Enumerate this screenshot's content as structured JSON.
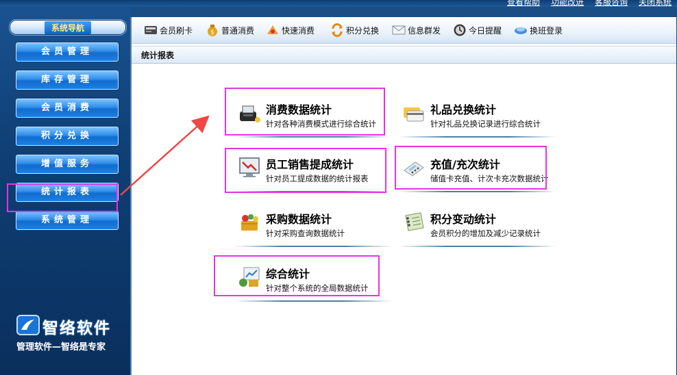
{
  "top_links": [
    "查看帮助",
    "功能改进",
    "客服咨询",
    "关闭系统"
  ],
  "sidebar": {
    "title": "系统导航",
    "items": [
      {
        "label": "会员管理"
      },
      {
        "label": "库存管理"
      },
      {
        "label": "会员消费"
      },
      {
        "label": "积分兑换"
      },
      {
        "label": "增值服务"
      },
      {
        "label": "统计报表"
      },
      {
        "label": "系统管理"
      }
    ],
    "logo": "智络软件",
    "slogan": "管理软件—智络是专家"
  },
  "toolbar": {
    "items": [
      {
        "label": "会员刷卡",
        "icon": "card-reader-icon"
      },
      {
        "label": "普通消费",
        "icon": "money-bag-icon"
      },
      {
        "label": "快速消费",
        "icon": "fast-consume-icon"
      },
      {
        "label": "积分兑换",
        "icon": "exchange-icon"
      },
      {
        "label": "信息群发",
        "icon": "envelope-icon"
      },
      {
        "label": "今日提醒",
        "icon": "clock-icon"
      },
      {
        "label": "换班登录",
        "icon": "shift-login-icon"
      }
    ]
  },
  "page": {
    "title": "统计报表"
  },
  "stats": [
    {
      "title": "消费数据统计",
      "desc": "针对各种消费模式进行综合统计",
      "icon": "pos-terminal-icon",
      "highlighted": true
    },
    {
      "title": "礼品兑换统计",
      "desc": "针对礼品兑换记录进行综合统计",
      "icon": "gift-cards-icon",
      "highlighted": false
    },
    {
      "title": "员工销售提成统计",
      "desc": "针对员工提成数据的统计报表",
      "icon": "monitor-chart-icon",
      "highlighted": true
    },
    {
      "title": "充值/充次统计",
      "desc": "储值卡充值、计次卡充次数据统计",
      "icon": "calculator-icon",
      "highlighted": true
    },
    {
      "title": "采购数据统计",
      "desc": "针对采购查询数据统计",
      "icon": "purchase-basket-icon",
      "highlighted": false
    },
    {
      "title": "积分变动统计",
      "desc": "会员积分的增加及减少记录统计",
      "icon": "notebook-icon",
      "highlighted": false
    },
    {
      "title": "综合统计",
      "desc": "针对整个系统的全局数据统计",
      "icon": "overall-chart-icon",
      "highlighted": true
    }
  ]
}
